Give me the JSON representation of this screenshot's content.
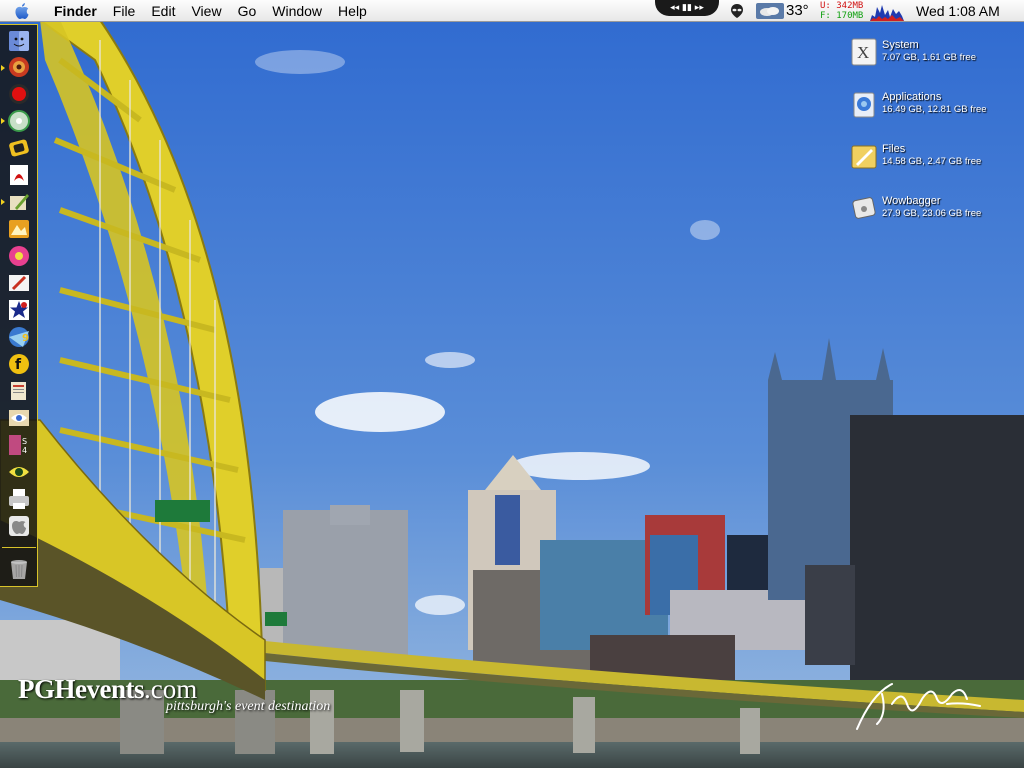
{
  "menubar": {
    "app_name": "Finder",
    "items": [
      "File",
      "Edit",
      "View",
      "Go",
      "Window",
      "Help"
    ],
    "itunes_controls": "◂◂ ▮▮ ▸▸",
    "weather_temp": "33°",
    "memory_used": "U: 342MB",
    "memory_free": "F: 170MB",
    "clock": "Wed 1:08 AM"
  },
  "dock": {
    "icons": [
      "finder-icon",
      "webbrowser-icon",
      "record-icon",
      "cd-icon",
      "text-editor-icon",
      "acrobat-icon",
      "pencil-icon",
      "photo-icon",
      "flower-icon",
      "pen-tablet-icon",
      "star-icon",
      "network-icon",
      "flash-icon",
      "documents-icon",
      "eye-icon",
      "photoshop-cs4-icon",
      "eye-icon-2",
      "printer-icon",
      "apple-icon"
    ],
    "running_indices": [
      1,
      3,
      6
    ],
    "trash_icon": "trash-icon"
  },
  "desktop": {
    "volumes": [
      {
        "name": "System",
        "info": "7.07 GB, 1.61 GB free",
        "icon": "osx-disk-icon"
      },
      {
        "name": "Applications",
        "info": "16.49 GB, 12.81 GB free",
        "icon": "applications-disk-icon"
      },
      {
        "name": "Files",
        "info": "14.58 GB, 2.47 GB free",
        "icon": "files-disk-icon"
      },
      {
        "name": "Wowbagger",
        "info": "27.9 GB, 23.06 GB free",
        "icon": "external-disk-icon"
      }
    ]
  },
  "wallpaper": {
    "brand_bold": "PGHevents",
    "brand_domain": ".com",
    "tagline": "pittsburgh's event destination"
  },
  "colors": {
    "dock_border": "#d8c32a",
    "bridge_yellow": "#e8d630",
    "sky": "#4a7fd0"
  }
}
